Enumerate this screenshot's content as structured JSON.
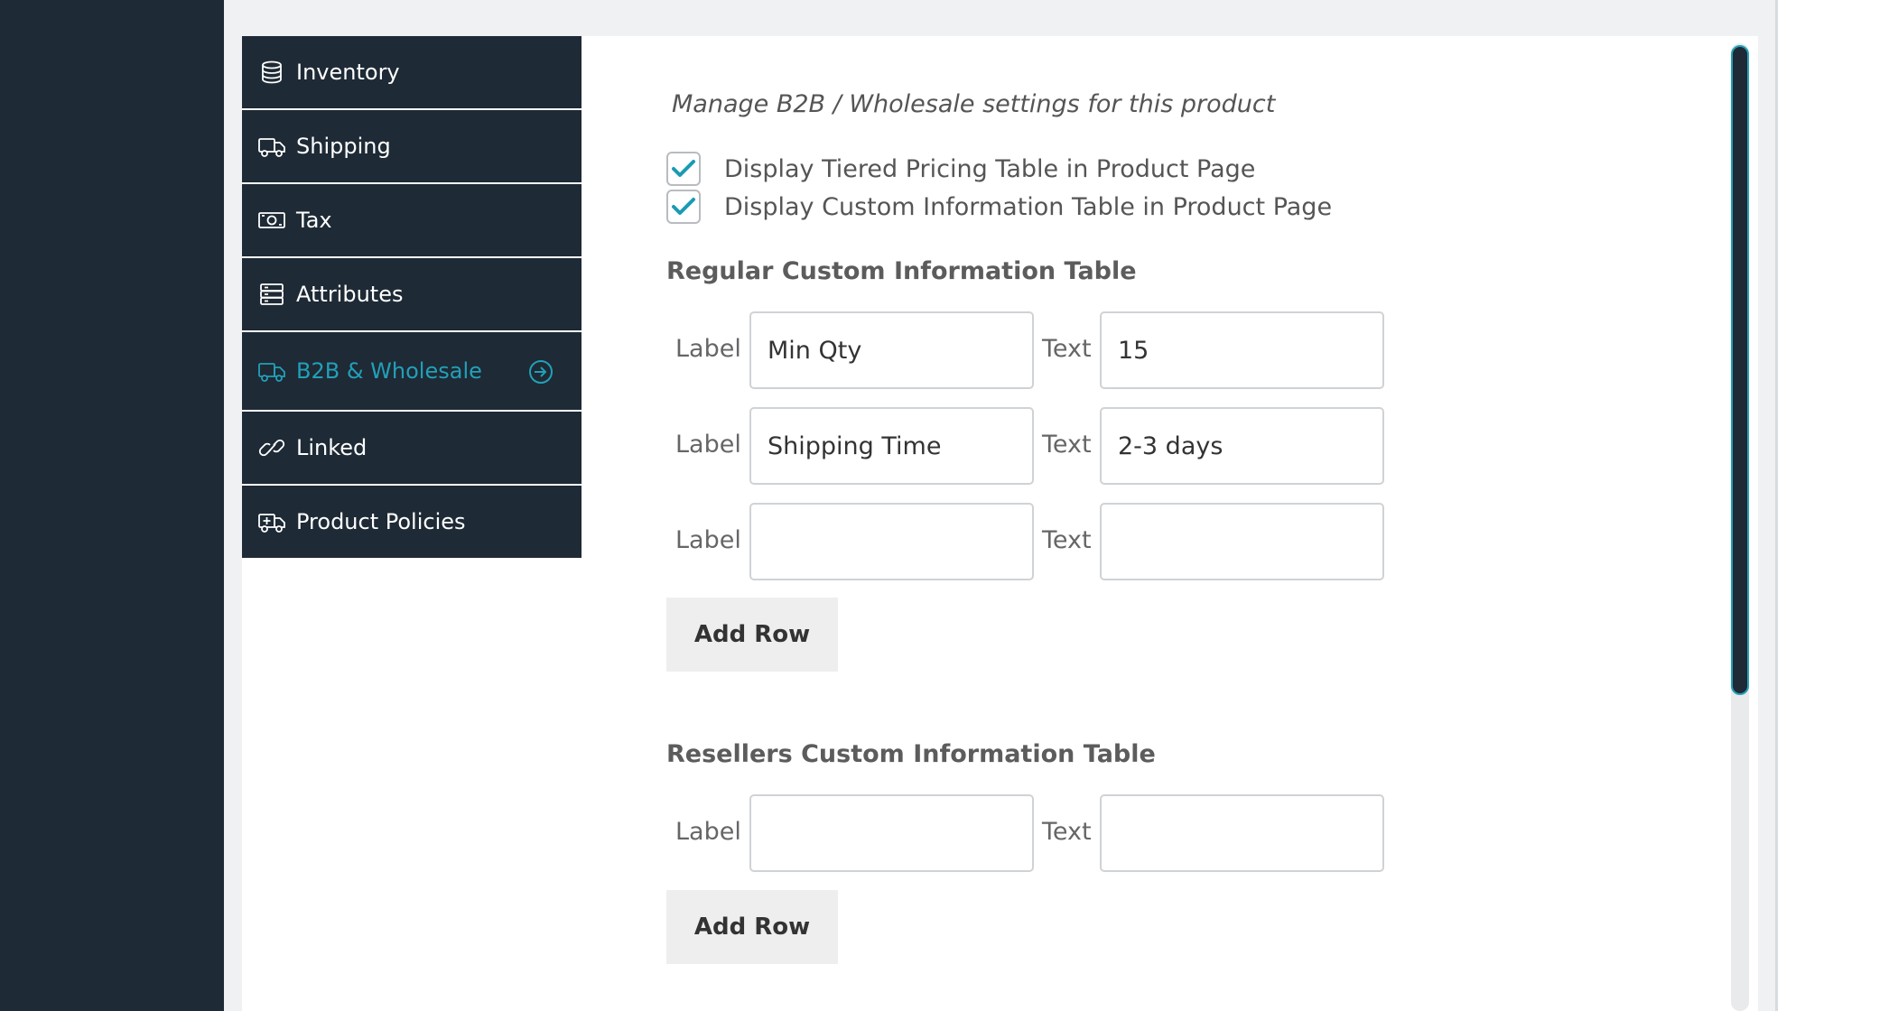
{
  "tabs": [
    {
      "label": "Inventory",
      "icon": "database-icon"
    },
    {
      "label": "Shipping",
      "icon": "truck-icon"
    },
    {
      "label": "Tax",
      "icon": "money-icon"
    },
    {
      "label": "Attributes",
      "icon": "server-icon"
    },
    {
      "label": "B2B & Wholesale",
      "icon": "truck-icon",
      "active": true
    },
    {
      "label": "Linked",
      "icon": "link-icon"
    },
    {
      "label": "Product Policies",
      "icon": "ambulance-icon"
    }
  ],
  "main": {
    "heading": "Manage B2B / Wholesale settings for this product",
    "checkboxes": [
      {
        "label": "Display Tiered Pricing Table in Product Page",
        "checked": true
      },
      {
        "label": "Display Custom Information Table in Product Page",
        "checked": true
      }
    ],
    "regular": {
      "title": "Regular Custom Information Table",
      "rows": [
        {
          "label_caption": "Label",
          "label_value": "Min Qty",
          "text_caption": "Text",
          "text_value": "15"
        },
        {
          "label_caption": "Label",
          "label_value": "Shipping Time",
          "text_caption": "Text",
          "text_value": "2-3 days"
        },
        {
          "label_caption": "Label",
          "label_value": "",
          "text_caption": "Text",
          "text_value": ""
        }
      ],
      "add_row_label": "Add Row"
    },
    "resellers": {
      "title": "Resellers Custom Information Table",
      "rows": [
        {
          "label_caption": "Label",
          "label_value": "",
          "text_caption": "Text",
          "text_value": ""
        }
      ],
      "add_row_label": "Add Row"
    }
  },
  "colors": {
    "sidebar": "#1e2a35",
    "accent": "#22a0b8",
    "background": "#f0f1f3"
  }
}
